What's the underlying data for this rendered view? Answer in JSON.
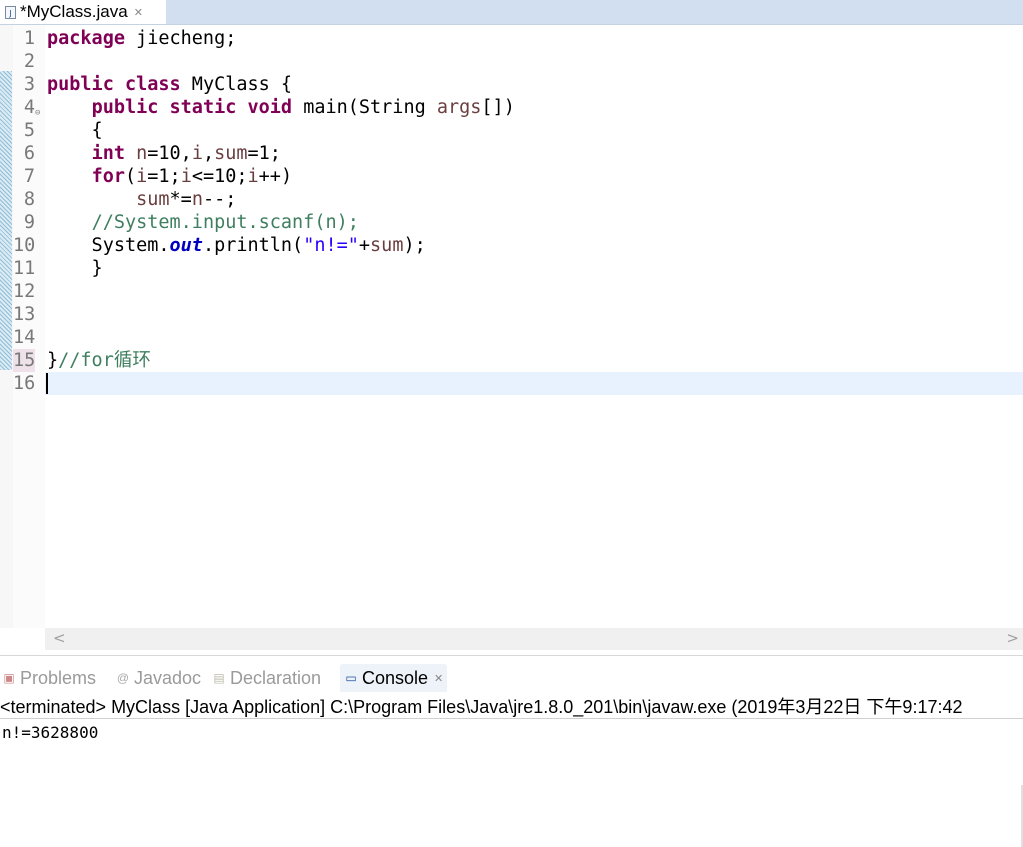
{
  "editor": {
    "tab_title": "*MyClass.java",
    "tab_icon": "java-file-icon",
    "close_icon": "close-icon",
    "lines": [
      {
        "n": "1",
        "tokens": [
          [
            "package",
            "kw"
          ],
          [
            " jiecheng;",
            ""
          ]
        ]
      },
      {
        "n": "2",
        "tokens": []
      },
      {
        "n": "3",
        "tokens": [
          [
            "public",
            "kw"
          ],
          [
            " ",
            ""
          ],
          [
            "class",
            "kw"
          ],
          [
            " MyClass {",
            ""
          ]
        ]
      },
      {
        "n": "4",
        "fold": true,
        "tokens": [
          [
            "    ",
            ""
          ],
          [
            "public",
            "kw"
          ],
          [
            " ",
            ""
          ],
          [
            "static",
            "kw"
          ],
          [
            " ",
            ""
          ],
          [
            "void",
            "kw"
          ],
          [
            " main(String ",
            ""
          ],
          [
            "args",
            "var"
          ],
          [
            "[])",
            ""
          ]
        ]
      },
      {
        "n": "5",
        "tokens": [
          [
            "    {",
            ""
          ]
        ]
      },
      {
        "n": "6",
        "tokens": [
          [
            "    ",
            ""
          ],
          [
            "int",
            "kw"
          ],
          [
            " ",
            ""
          ],
          [
            "n",
            "var"
          ],
          [
            "=10,",
            ""
          ],
          [
            "i",
            "var"
          ],
          [
            ",",
            ""
          ],
          [
            "sum",
            "var"
          ],
          [
            "=1;",
            ""
          ]
        ]
      },
      {
        "n": "7",
        "tokens": [
          [
            "    ",
            ""
          ],
          [
            "for",
            "kw"
          ],
          [
            "(",
            ""
          ],
          [
            "i",
            "var"
          ],
          [
            "=1;",
            ""
          ],
          [
            "i",
            "var"
          ],
          [
            "<=10;",
            ""
          ],
          [
            "i",
            "var"
          ],
          [
            "++)",
            ""
          ]
        ]
      },
      {
        "n": "8",
        "tokens": [
          [
            "        ",
            ""
          ],
          [
            "sum",
            "var"
          ],
          [
            "*=",
            ""
          ],
          [
            "n",
            "var"
          ],
          [
            "--;",
            ""
          ]
        ]
      },
      {
        "n": "9",
        "tokens": [
          [
            "    ",
            ""
          ],
          [
            "//System.input.scanf(n);",
            "cm"
          ]
        ]
      },
      {
        "n": "10",
        "tokens": [
          [
            "    System.",
            ""
          ],
          [
            "out",
            "fld"
          ],
          [
            ".println(",
            ""
          ],
          [
            "\"n!=\"",
            "str"
          ],
          [
            "+",
            ""
          ],
          [
            "sum",
            "var"
          ],
          [
            ");",
            ""
          ]
        ]
      },
      {
        "n": "11",
        "tokens": [
          [
            "    }",
            ""
          ]
        ]
      },
      {
        "n": "12",
        "tokens": []
      },
      {
        "n": "13",
        "tokens": []
      },
      {
        "n": "14",
        "tokens": []
      },
      {
        "n": "15",
        "highlight": true,
        "tokens": [
          [
            "}",
            ""
          ],
          [
            "//for循环",
            "cm"
          ]
        ]
      },
      {
        "n": "16",
        "current": true,
        "tokens": []
      }
    ]
  },
  "console": {
    "tabs": [
      {
        "label": "Problems",
        "icon": "problems-icon",
        "active": false
      },
      {
        "label": "Javadoc",
        "icon": "javadoc-icon",
        "active": false
      },
      {
        "label": "Declaration",
        "icon": "declaration-icon",
        "active": false
      },
      {
        "label": "Console",
        "icon": "console-icon",
        "active": true
      }
    ],
    "status": "<terminated> MyClass [Java Application] C:\\Program Files\\Java\\jre1.8.0_201\\bin\\javaw.exe (2019年3月22日 下午9:17:42",
    "output": "n!=3628800"
  }
}
